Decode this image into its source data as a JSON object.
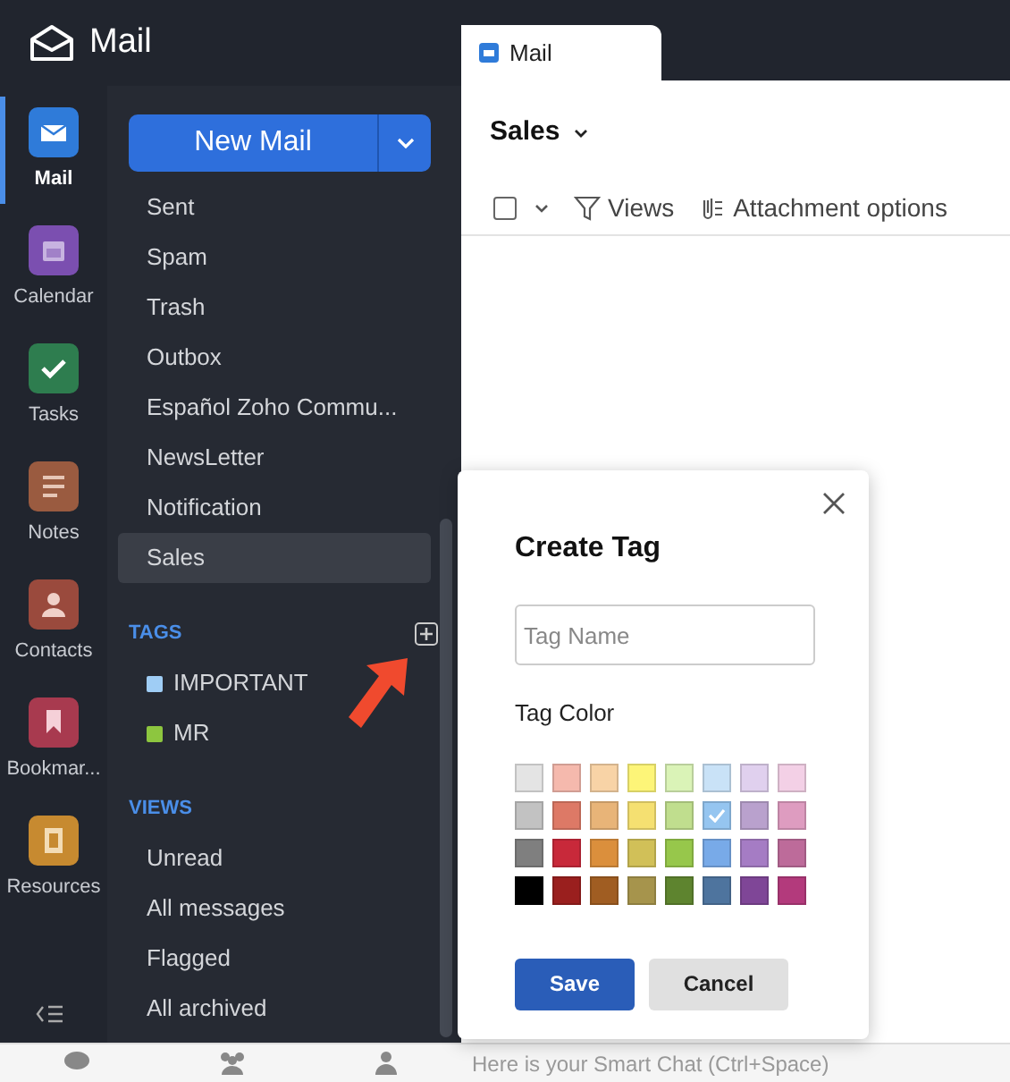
{
  "app": {
    "title": "Mail"
  },
  "rail": [
    {
      "label": "Mail",
      "selected": true,
      "kind": "mail",
      "color": "#2f7bd9"
    },
    {
      "label": "Calendar",
      "selected": false,
      "kind": "calendar",
      "color": "#7b4fb0"
    },
    {
      "label": "Tasks",
      "selected": false,
      "kind": "tasks",
      "color": "#2e7d4f"
    },
    {
      "label": "Notes",
      "selected": false,
      "kind": "notes",
      "color": "#9a5b40"
    },
    {
      "label": "Contacts",
      "selected": false,
      "kind": "contacts",
      "color": "#9a4a3d"
    },
    {
      "label": "Bookmar...",
      "selected": false,
      "kind": "bookmarks",
      "color": "#a83a4f"
    },
    {
      "label": "Resources",
      "selected": false,
      "kind": "resources",
      "color": "#c78a30"
    }
  ],
  "new_mail": {
    "label": "New Mail"
  },
  "folders": [
    {
      "label": "Sent",
      "selected": false
    },
    {
      "label": "Spam",
      "selected": false
    },
    {
      "label": "Trash",
      "selected": false
    },
    {
      "label": "Outbox",
      "selected": false
    },
    {
      "label": "Español Zoho Commu...",
      "selected": false
    },
    {
      "label": "NewsLetter",
      "selected": false
    },
    {
      "label": "Notification",
      "selected": false
    },
    {
      "label": "Sales",
      "selected": true
    }
  ],
  "tags": {
    "heading": "TAGS",
    "items": [
      {
        "label": "IMPORTANT",
        "color": "#9fcdf5"
      },
      {
        "label": "MR",
        "color": "#8dc63f"
      }
    ]
  },
  "views": {
    "heading": "VIEWS",
    "items": [
      {
        "label": "Unread"
      },
      {
        "label": "All messages"
      },
      {
        "label": "Flagged"
      },
      {
        "label": "All archived"
      }
    ]
  },
  "tab": {
    "label": "Mail"
  },
  "folder_title": "Sales",
  "toolbar": {
    "select_all_checked": false,
    "views": "Views",
    "attachments": "Attachment options"
  },
  "chat_hint": "Here is your Smart Chat (Ctrl+Space)",
  "dialog": {
    "title": "Create Tag",
    "name_field": {
      "placeholder": "Tag Name"
    },
    "color_label": "Tag Color",
    "colors": [
      {
        "color": "#e4e4e4",
        "selected": false
      },
      {
        "color": "#f5b9ad",
        "selected": false
      },
      {
        "color": "#f8d3a6",
        "selected": false
      },
      {
        "color": "#fdf578",
        "selected": false
      },
      {
        "color": "#daf3b7",
        "selected": false
      },
      {
        "color": "#c9e2f7",
        "selected": false
      },
      {
        "color": "#e0d0ee",
        "selected": false
      },
      {
        "color": "#f3d0e6",
        "selected": false
      },
      {
        "color": "#c2c2c2",
        "selected": false
      },
      {
        "color": "#dd7966",
        "selected": false
      },
      {
        "color": "#e8b478",
        "selected": false
      },
      {
        "color": "#f5e071",
        "selected": false
      },
      {
        "color": "#c0de8e",
        "selected": false
      },
      {
        "color": "#95c5f0",
        "selected": true
      },
      {
        "color": "#b9a1cd",
        "selected": false
      },
      {
        "color": "#de9cc0",
        "selected": false
      },
      {
        "color": "#7f7f7f",
        "selected": false
      },
      {
        "color": "#c8293a",
        "selected": false
      },
      {
        "color": "#db8f3c",
        "selected": false
      },
      {
        "color": "#d1c058",
        "selected": false
      },
      {
        "color": "#97c74b",
        "selected": false
      },
      {
        "color": "#78aae8",
        "selected": false
      },
      {
        "color": "#a57cc4",
        "selected": false
      },
      {
        "color": "#bd6b9a",
        "selected": false
      },
      {
        "color": "#000000",
        "selected": false
      },
      {
        "color": "#9a1f1e",
        "selected": false
      },
      {
        "color": "#a05d22",
        "selected": false
      },
      {
        "color": "#a6944c",
        "selected": false
      },
      {
        "color": "#5e842f",
        "selected": false
      },
      {
        "color": "#4e749e",
        "selected": false
      },
      {
        "color": "#7f4697",
        "selected": false
      },
      {
        "color": "#b33a7c",
        "selected": false
      }
    ],
    "buttons": [
      {
        "label": "Save",
        "kind": "primary"
      },
      {
        "label": "Cancel",
        "kind": "secondary"
      }
    ]
  }
}
